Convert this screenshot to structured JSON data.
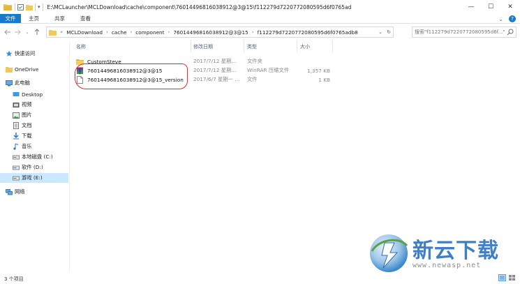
{
  "window": {
    "path_title": "E:\\MCLauncher\\MCLDownload\\cache\\component\\76014496816038912@3@15\\f112279d7220772080595d6f0765ad",
    "minimize": "—",
    "maximize": "☐",
    "close": "✕"
  },
  "ribbon": {
    "tabs": [
      "文件",
      "主页",
      "共享",
      "查看"
    ],
    "expand_icon": "⌄"
  },
  "address": {
    "crumbs": [
      "MCLDownload",
      "cache",
      "component",
      "76014496816038912@3@15",
      "f112279d7220772080595d6f0765adb8"
    ],
    "prefix": "«"
  },
  "search": {
    "placeholder": "搜索\"f112279d7220772080595d6f...\""
  },
  "nav": {
    "items": [
      {
        "label": "快速访问",
        "icon": "star-icon",
        "indent": 0
      },
      {
        "label": "OneDrive",
        "icon": "cloud-folder-icon",
        "indent": 0
      },
      {
        "label": "此电脑",
        "icon": "computer-icon",
        "indent": 0
      },
      {
        "label": "Desktop",
        "icon": "desktop-icon",
        "indent": 1
      },
      {
        "label": "视频",
        "icon": "video-icon",
        "indent": 1
      },
      {
        "label": "图片",
        "icon": "picture-icon",
        "indent": 1
      },
      {
        "label": "文档",
        "icon": "document-icon",
        "indent": 1
      },
      {
        "label": "下载",
        "icon": "download-icon",
        "indent": 1
      },
      {
        "label": "音乐",
        "icon": "music-icon",
        "indent": 1
      },
      {
        "label": "本地磁盘 (C:)",
        "icon": "drive-icon",
        "indent": 1
      },
      {
        "label": "软件 (D:)",
        "icon": "drive-icon",
        "indent": 1
      },
      {
        "label": "游戏 (E:)",
        "icon": "drive-icon",
        "indent": 1,
        "selected": true
      },
      {
        "label": "网络",
        "icon": "network-icon",
        "indent": 0
      }
    ]
  },
  "columns": {
    "name": "名称",
    "date": "修改日期",
    "type": "类型",
    "size": "大小"
  },
  "files": [
    {
      "name": "CustomSteve",
      "date": "2017/7/12 星期...",
      "type": "文件夹",
      "size": "",
      "icon": "folder-icon"
    },
    {
      "name": "76014496816038912@3@15",
      "date": "2017/7/12 星期...",
      "type": "WinRAR 压缩文件",
      "size": "1,357 KB",
      "icon": "winrar-icon"
    },
    {
      "name": "76014496816038912@3@15_version",
      "date": "2017/6/7 星期一 ...",
      "type": "文件",
      "size": "1 KB",
      "icon": "file-icon"
    }
  ],
  "status": {
    "count": "3 个项目"
  },
  "watermark": {
    "title": "新云下载",
    "url": "www.newasp.net"
  },
  "colors": {
    "accent": "#1979ca",
    "selection": "#cce8ff",
    "annotation": "#e8262b",
    "folder": "#f0c95a"
  }
}
